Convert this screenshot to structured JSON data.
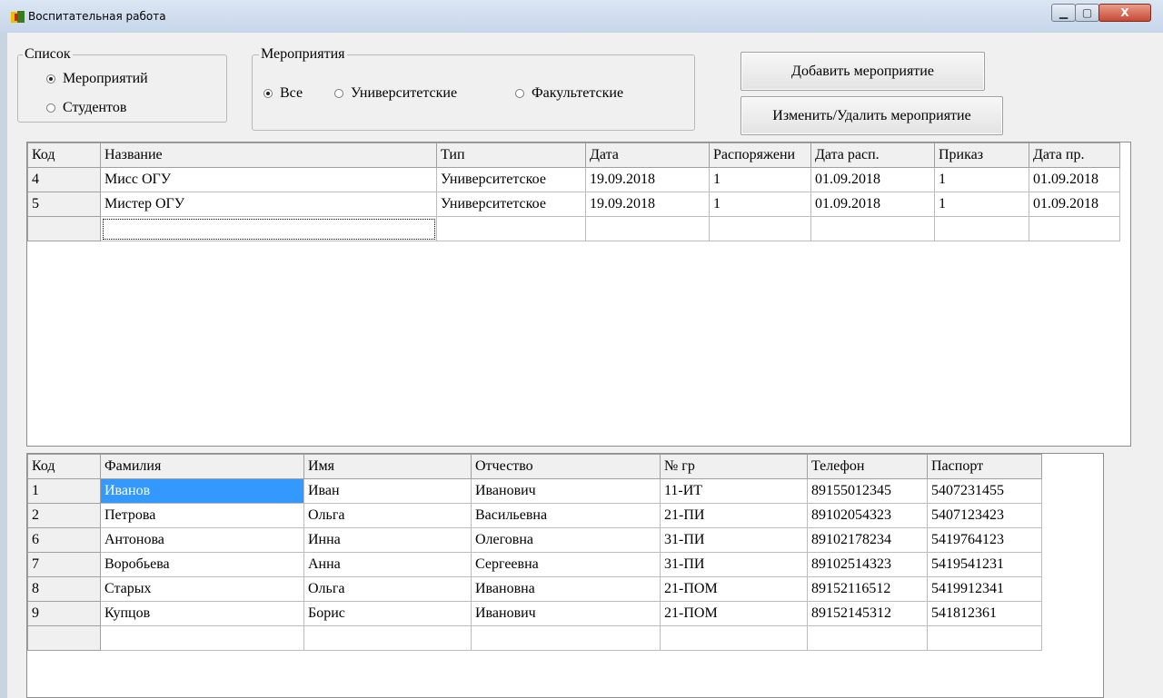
{
  "window": {
    "title": "Воспитательная работа",
    "controls": {
      "minimize": "▁",
      "maximize": "▢",
      "close": "X"
    }
  },
  "list_group": {
    "legend": "Список",
    "options": [
      {
        "label": "Мероприятий",
        "selected": true
      },
      {
        "label": "Студентов",
        "selected": false
      }
    ]
  },
  "events_group": {
    "legend": "Мероприятия",
    "options": [
      {
        "label": "Все",
        "selected": true
      },
      {
        "label": "Университетские",
        "selected": false
      },
      {
        "label": "Факультетские",
        "selected": false
      }
    ]
  },
  "buttons": {
    "add": "Добавить мероприятие",
    "edit_delete": "Изменить/Удалить мероприятие"
  },
  "events_table": {
    "headers": [
      "Код",
      "Название",
      "Тип",
      "Дата",
      "Распоряжени",
      "Дата расп.",
      "Приказ",
      "Дата пр."
    ],
    "rows": [
      [
        "4",
        "Мисс ОГУ",
        "Университетское",
        "19.09.2018",
        "1",
        "01.09.2018",
        "1",
        "01.09.2018"
      ],
      [
        "5",
        "Мистер ОГУ",
        "Университетское",
        "19.09.2018",
        "1",
        "01.09.2018",
        "1",
        "01.09.2018"
      ],
      [
        "",
        "",
        "",
        "",
        "",
        "",
        "",
        ""
      ]
    ]
  },
  "students_table": {
    "headers": [
      "Код",
      "Фамилия",
      "Имя",
      "Отчество",
      "№ гр",
      "Телефон",
      "Паспорт"
    ],
    "rows": [
      [
        "1",
        "Иванов",
        "Иван",
        "Иванович",
        "11-ИТ",
        "89155012345",
        "5407231455"
      ],
      [
        "2",
        "Петрова",
        "Ольга",
        "Васильевна",
        "21-ПИ",
        "89102054323",
        "5407123423"
      ],
      [
        "6",
        "Антонова",
        "Инна",
        "Олеговна",
        "31-ПИ",
        "89102178234",
        "5419764123"
      ],
      [
        "7",
        "Воробьева",
        "Анна",
        "Сергеевна",
        "31-ПИ",
        "89102514323",
        "5419541231"
      ],
      [
        "8",
        "Старых",
        "Ольга",
        "Ивановна",
        "21-ПОМ",
        "89152116512",
        "5419912341"
      ],
      [
        "9",
        "Купцов",
        "Борис",
        "Иванович",
        "21-ПОМ",
        "89152145312",
        "541812361"
      ],
      [
        "",
        "",
        "",
        "",
        "",
        "",
        ""
      ]
    ]
  }
}
